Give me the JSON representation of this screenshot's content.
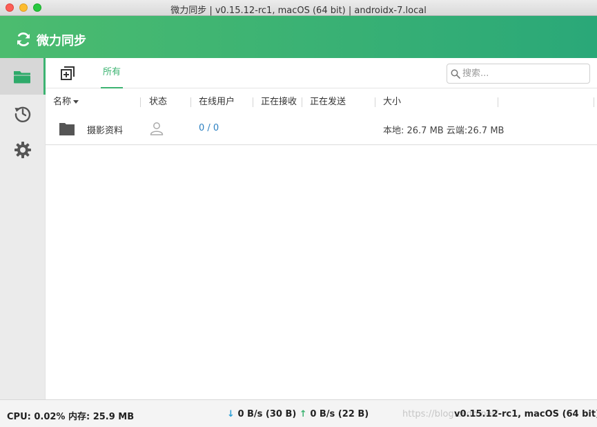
{
  "window": {
    "title": "微力同步 | v0.15.12-rc1, macOS (64 bit) | androidx-7.local"
  },
  "header": {
    "app_name": "微力同步",
    "logo_icon": "sync-icon"
  },
  "sidebar": {
    "items": [
      {
        "name": "folders",
        "icon": "folder-icon",
        "active": true
      },
      {
        "name": "history",
        "icon": "history-icon",
        "active": false
      },
      {
        "name": "settings",
        "icon": "gear-icon",
        "active": false
      }
    ]
  },
  "toolbar": {
    "add_icon": "add-folder-icon",
    "tab_all": "所有"
  },
  "search": {
    "placeholder": "搜索..."
  },
  "table": {
    "columns": [
      "名称",
      "状态",
      "在线用户",
      "正在接收",
      "正在发送",
      "大小"
    ],
    "rows": [
      {
        "name": "摄影资料",
        "status_icon": "user-icon",
        "online_users": "0 / 0",
        "receiving": "",
        "sending": "",
        "size": "本地: 26.7 MB 云端:26.7 MB"
      }
    ]
  },
  "statusbar": {
    "cpu_mem": "CPU: 0.02% 内存: 25.9 MB",
    "download": "0 B/s (30 B)",
    "upload": "0 B/s (22 B)",
    "version": "v0.15.12-rc1, macOS (64 bit)",
    "watermark": "https://blog.csdn.net/"
  },
  "colors": {
    "accent": "#3cb371",
    "header_start": "#4cbc6f",
    "header_end": "#2aa878",
    "link": "#2a7fc1"
  }
}
